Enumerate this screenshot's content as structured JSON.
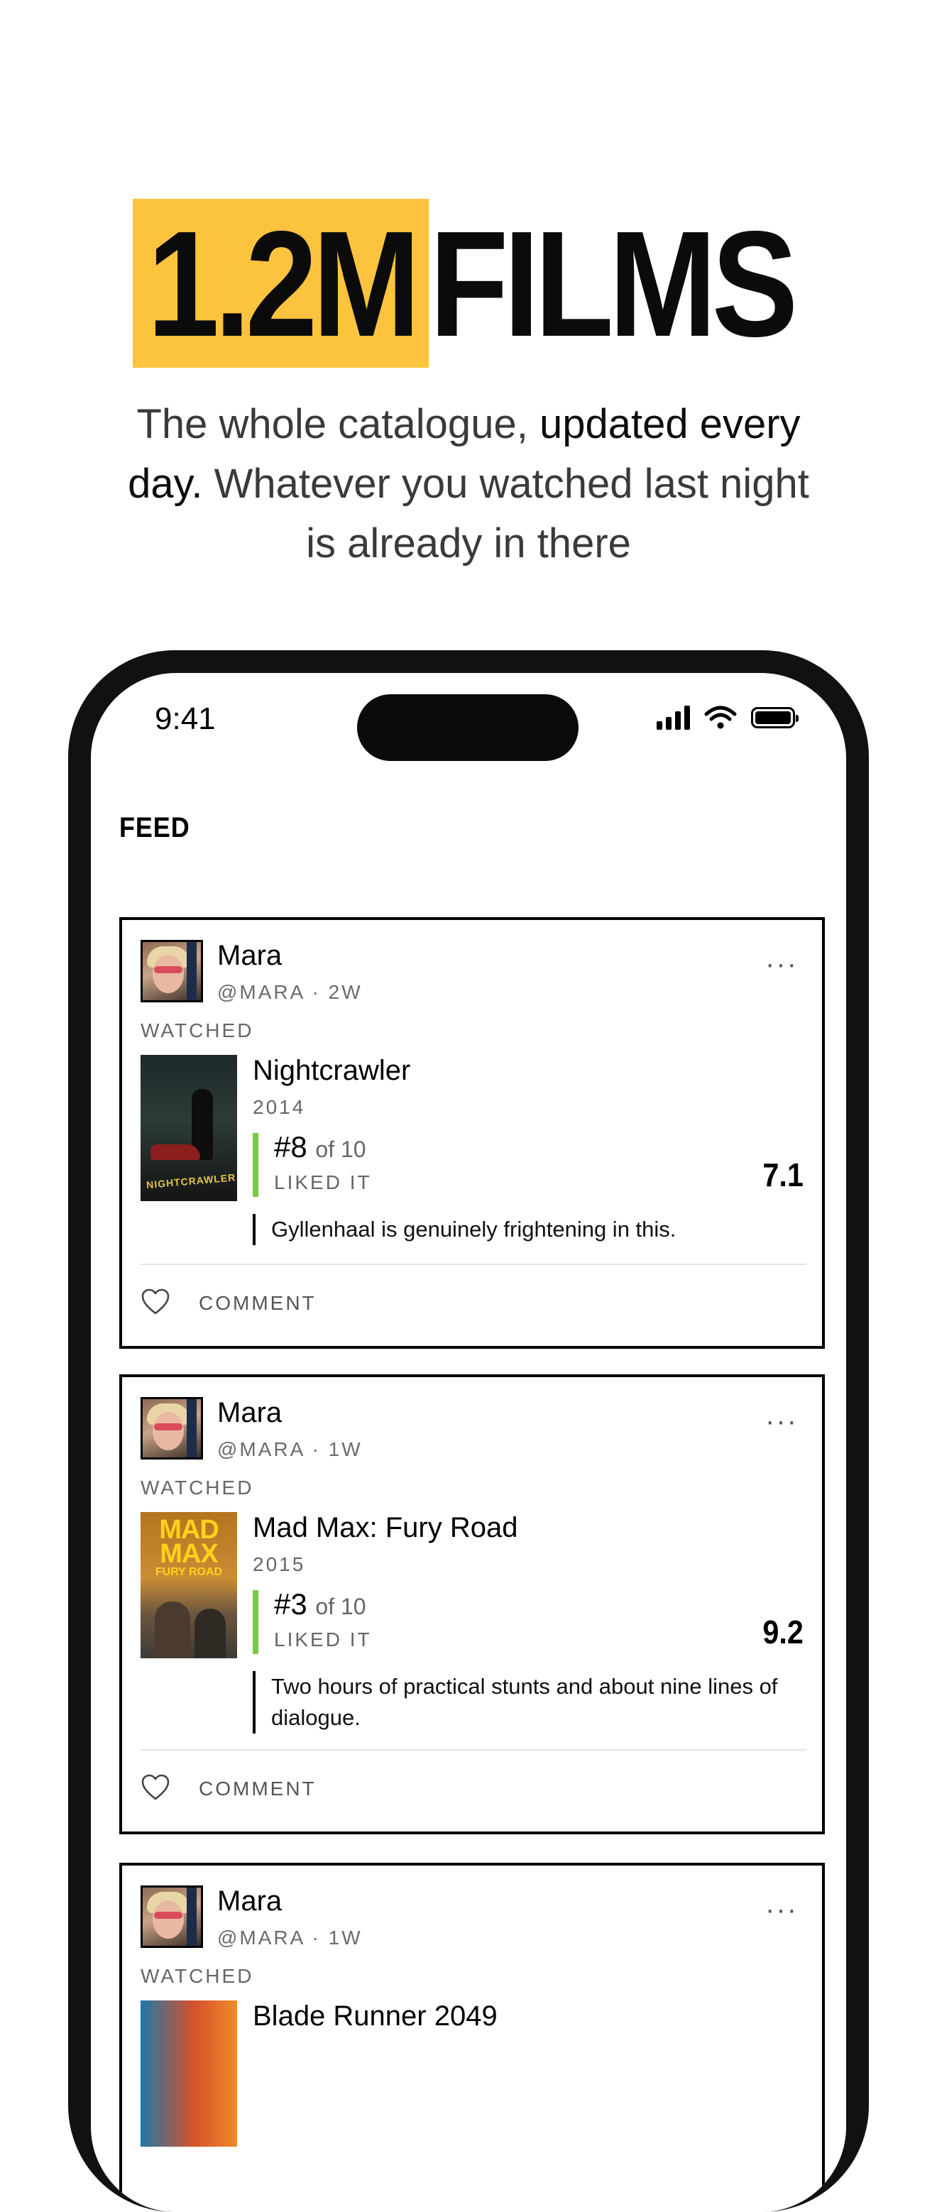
{
  "promo": {
    "headline_highlight": "1.2M",
    "headline_rest": "FILMS",
    "subtitle_part1": "The whole catalogue, ",
    "subtitle_dark1": "updated every day.",
    "subtitle_part2": " Whatever you watched last night is already in there",
    "highlight_color": "#fcc33f"
  },
  "status_bar": {
    "time": "9:41"
  },
  "feed": {
    "title": "FEED",
    "posts": [
      {
        "user": "Mara",
        "handle": "@MARA · 2W",
        "action": "WATCHED",
        "film": "Nightcrawler",
        "year": "2014",
        "rank": "#8",
        "rank_of": "of 10",
        "verdict": "LIKED IT",
        "score": "7.1",
        "review": "Gyllenhaal is genuinely frightening in this.",
        "comment_label": "COMMENT",
        "more": "···",
        "poster_text": "NIGHTCRAWLER"
      },
      {
        "user": "Mara",
        "handle": "@MARA · 1W",
        "action": "WATCHED",
        "film": "Mad Max: Fury Road",
        "year": "2015",
        "rank": "#3",
        "rank_of": "of 10",
        "verdict": "LIKED IT",
        "score": "9.2",
        "review": "Two hours of practical stunts and about nine lines of dialogue.",
        "comment_label": "COMMENT",
        "more": "···",
        "poster_text_line1": "MAD",
        "poster_text_line2": "MAX",
        "poster_text_line3": "FURY ROAD"
      },
      {
        "user": "Mara",
        "handle": "@MARA · 1W",
        "action": "WATCHED",
        "film": "Blade Runner 2049",
        "more": "···"
      }
    ]
  },
  "colors": {
    "liked_bar": "#7ac943",
    "frame": "#111111"
  }
}
